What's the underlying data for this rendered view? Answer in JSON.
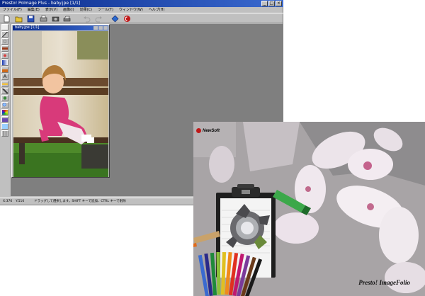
{
  "app": {
    "title": "Presto! PoImage Plus - baby.jpe [1/1]",
    "menus": [
      "ファイル(F)",
      "編集(E)",
      "表示(V)",
      "画像(I)",
      "効果(C)",
      "ツール(T)",
      "ウィンドウ(W)",
      "ヘルプ(H)"
    ],
    "toolbar_icons": [
      "new-icon",
      "open-icon",
      "save-icon",
      "print-icon",
      "acquire-icon",
      "scan-icon",
      "undo-icon",
      "redo-icon",
      "imagefolio-icon",
      "newsoft-icon"
    ],
    "tool_icons": [
      "marquee-icon",
      "line-icon",
      "lasso-icon",
      "brush-icon",
      "airbrush-icon",
      "gradient-icon",
      "fill-icon",
      "text-icon",
      "eraser-icon",
      "pen-icon",
      "clone-icon",
      "zoom-icon",
      "color-icon",
      "stamp-icon",
      "crop-icon",
      "grid-icon"
    ],
    "status": {
      "coord_x": "X:376",
      "coord_y": "Y:510",
      "hint": "ドラッグして選択します。SHIFT キーで追加、CTRL キーで削除"
    }
  },
  "document": {
    "title": "baby.jpe [1/1]"
  },
  "cover": {
    "logo": "NewSoft",
    "brand": "Presto! ImageFolio"
  },
  "colors": {
    "titlebar": "#0a2a8a",
    "workspace": "#7f7f7f",
    "chrome": "#c0c0c0",
    "accent": "#c01818"
  }
}
